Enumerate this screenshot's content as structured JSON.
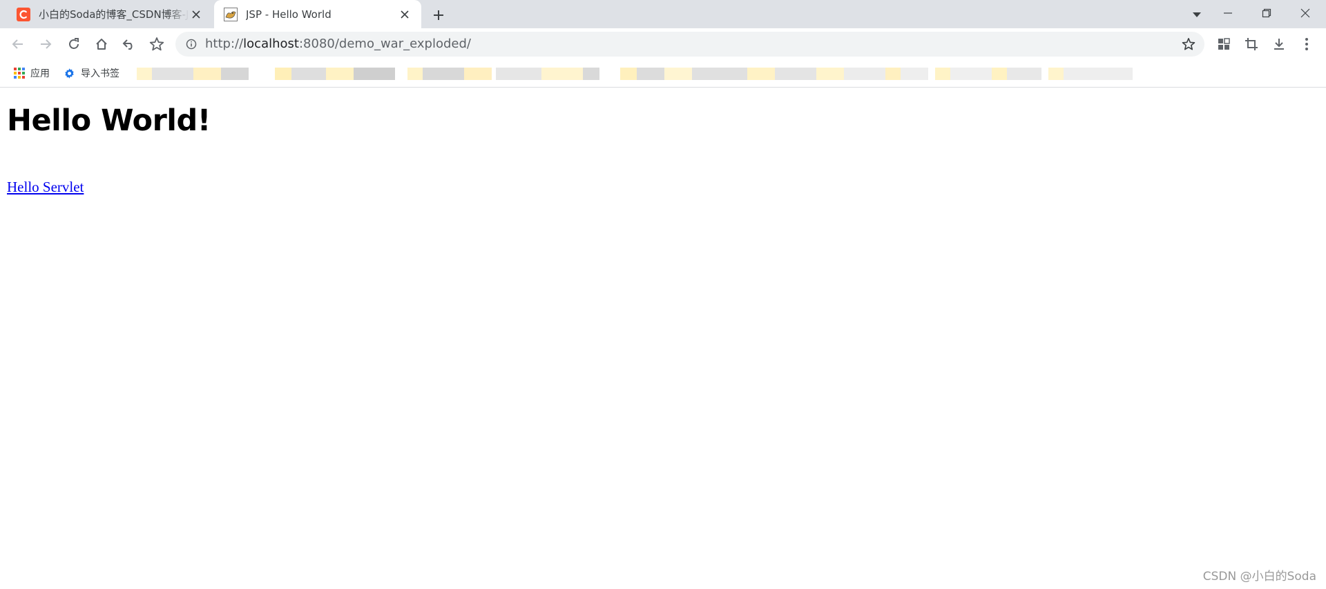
{
  "browser": {
    "tabs": [
      {
        "title": "小白的Soda的博客_CSDN博客-J",
        "favicon": "csdn-logo-icon",
        "active": false
      },
      {
        "title": "JSP - Hello World",
        "favicon": "tomcat-favicon-icon",
        "active": true
      }
    ],
    "address_bar": {
      "scheme": "http://",
      "host": "localhost",
      "rest": ":8080/demo_war_exploded/"
    },
    "bookmarks": [
      {
        "label": "应用",
        "icon": "apps-grid-icon"
      },
      {
        "label": "导入书签",
        "icon": "gear-icon"
      }
    ],
    "colors": {
      "tabstrip": "#dee1e6",
      "omnibox": "#f1f3f4",
      "csdn_red": "#fc5531",
      "link": "#0000ee"
    }
  },
  "page": {
    "heading": "Hello World!",
    "link": "Hello Servlet"
  },
  "watermark": "CSDN @小白的Soda"
}
